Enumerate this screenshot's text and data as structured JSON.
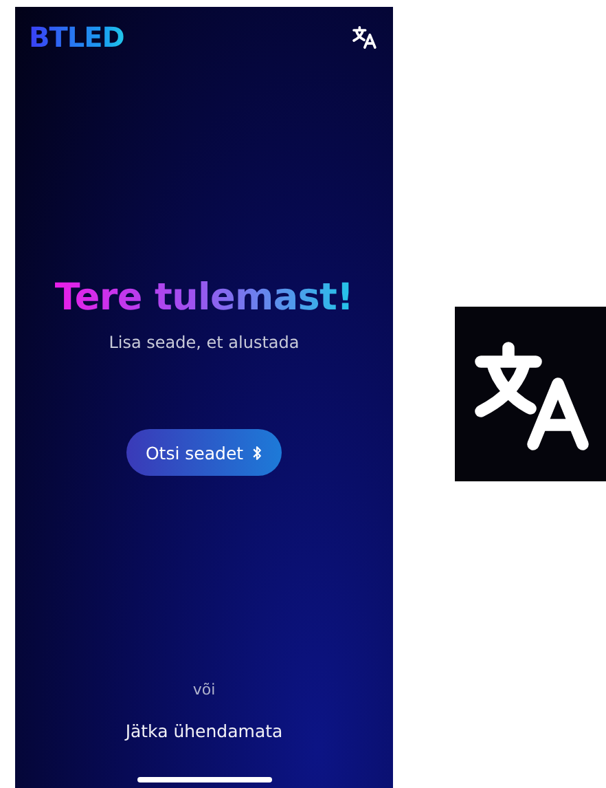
{
  "app": {
    "logo": "BTLED"
  },
  "welcome": {
    "title": "Tere tulemast!",
    "subtitle": "Lisa seade, et alustada"
  },
  "search_button": {
    "label": "Otsi seadet"
  },
  "separator": "või",
  "skip_link": "Jätka ühendamata"
}
